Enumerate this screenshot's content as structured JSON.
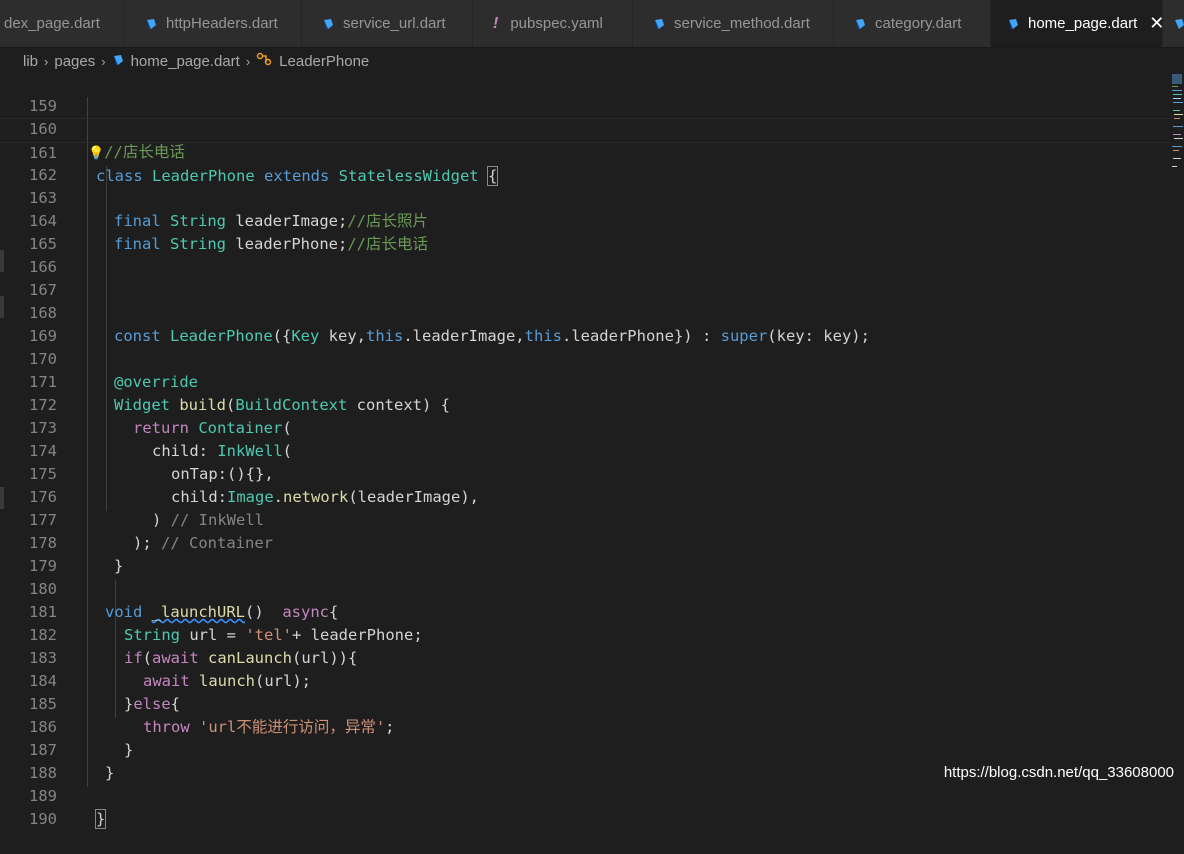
{
  "tabs": [
    {
      "label": "dex_page.dart",
      "icon": "dart-file-icon"
    },
    {
      "label": "httpHeaders.dart",
      "icon": "dart-file-icon"
    },
    {
      "label": "service_url.dart",
      "icon": "dart-file-icon"
    },
    {
      "label": "pubspec.yaml",
      "icon": "yaml-file-icon"
    },
    {
      "label": "service_method.dart",
      "icon": "dart-file-icon"
    },
    {
      "label": "category.dart",
      "icon": "dart-file-icon"
    },
    {
      "label": "home_page.dart",
      "icon": "dart-file-icon",
      "active": true,
      "close": "✕"
    }
  ],
  "breadcrumb": {
    "items": [
      "lib",
      "pages",
      "home_page.dart",
      "LeaderPhone"
    ],
    "separator": "›"
  },
  "editor": {
    "line_numbers": [
      "159",
      "160",
      "161",
      "162",
      "163",
      "164",
      "165",
      "166",
      "167",
      "168",
      "169",
      "170",
      "171",
      "172",
      "173",
      "174",
      "175",
      "176",
      "177",
      "178",
      "179",
      "180",
      "181",
      "182",
      "183",
      "184",
      "185",
      "186",
      "187",
      "188",
      "189",
      "190"
    ],
    "tokens": {
      "l160_icon": "💡",
      "l160_comment": "//店长电话",
      "l161_class": "class",
      "l161_name": " LeaderPhone ",
      "l161_extends": "extends",
      "l161_super": " StatelessWidget ",
      "l161_brace": "{",
      "l163_final": "final",
      "l163_type": " String",
      "l163_var": " leaderImage;",
      "l163_comment": "//店长照片",
      "l164_final": "final",
      "l164_type": " String",
      "l164_var": " leaderPhone;",
      "l164_comment": "//店长电话",
      "l168_const": "const",
      "l168_ctor": " LeaderPhone",
      "l168_p1": "({",
      "l168_key_t": "Key",
      "l168_p2": " key,",
      "l168_this1": "this",
      "l168_p3": ".leaderImage,",
      "l168_this2": "this",
      "l168_p4": ".leaderPhone}) : ",
      "l168_super": "super",
      "l168_p5": "(key: key);",
      "l170_override": "@override",
      "l171_widget": "Widget",
      "l171_build": " build",
      "l171_p1": "(",
      "l171_ctx_t": "BuildContext",
      "l171_p2": " context) {",
      "l172_return": "return",
      "l172_container": " Container",
      "l172_p": "(",
      "l173_child": "child: ",
      "l173_inkwell": "InkWell",
      "l173_p": "(",
      "l174_text": "onTap:(){},",
      "l175_child": "child:",
      "l175_image": "Image",
      "l175_dot": ".",
      "l175_network": "network",
      "l175_rest": "(leaderImage),",
      "l176_paren": ")",
      "l176_comment": " // InkWell",
      "l177_paren": ");",
      "l177_comment": " // Container",
      "l178_brace": "}",
      "l180_void": "void",
      "l180_space": " ",
      "l180_fn": "_launchURL",
      "l180_paren": "()",
      "l180_async": "  async",
      "l180_brace": "{",
      "l181_type": "String",
      "l181_p1": " url = ",
      "l181_str": "'tel'",
      "l181_p2": "+ leaderPhone;",
      "l182_if": "if",
      "l182_p1": "(",
      "l182_await": "await",
      "l182_fn": " canLaunch",
      "l182_p2": "(url)){",
      "l183_await": "await",
      "l183_fn": " launch",
      "l183_p": "(url);",
      "l184_close": "}",
      "l184_else": "else",
      "l184_open": "{",
      "l185_throw": "throw",
      "l185_str": " 'url不能进行访问，异常'",
      "l185_semi": ";",
      "l186_brace": "}",
      "l187_brace": "}",
      "l189_brace": "}"
    }
  },
  "watermark": "https://blog.csdn.net/qq_33608000",
  "colors": {
    "keyword": "#569cd6",
    "type": "#4ec9b0",
    "function": "#dcdcaa",
    "comment": "#6a9955",
    "string": "#ce9178",
    "control": "#c586c0",
    "text": "#d4d4d4",
    "dart_icon": "#42a5f5"
  }
}
